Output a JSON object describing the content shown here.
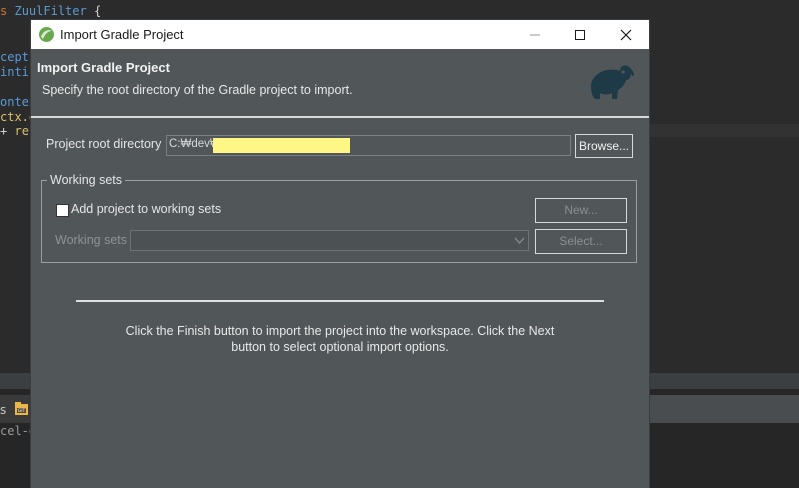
{
  "dialog": {
    "title": "Import Gradle Project",
    "header_title": "Import Gradle Project",
    "header_description": "Specify the root directory of the Gradle project to import.",
    "project_root_label": "Project root directory",
    "project_root_value": "C:₩dev₩",
    "browse_label": "Browse...",
    "working_sets_group_label": "Working sets",
    "add_to_working_sets_label": "Add project to working sets",
    "add_to_working_sets_checked": false,
    "new_label": "New...",
    "working_sets_label": "Working sets",
    "working_sets_value": "",
    "select_label": "Select...",
    "info_text": "Click the Finish button to import the project into the workspace. Click the Next button to select optional import options."
  },
  "background_editor": {
    "code_line_1_kw": "s",
    "code_line_1_type": "ZuulFilter",
    "code_line_1_rest": "{",
    "code_line_2": "cepti",
    "code_line_3": "intin",
    "code_line_4": "ontex",
    "code_line_5": "ctx.g",
    "code_line_6_kw": "+",
    "code_line_6_rest": "rec",
    "bottom_tab_fragment": "s",
    "console_fragment": "cel-do"
  },
  "colors": {
    "dialog_bg": "#515658",
    "editor_bg": "#2b2b2b",
    "redaction": "#fff785",
    "gradle_logo": "#1e3a46"
  },
  "icons": {
    "title": "eclipse-app-icon",
    "logo": "gradle-elephant-icon",
    "minimize": "minimize-icon",
    "maximize": "maximize-icon",
    "close": "close-icon",
    "combo": "chevron-down-icon"
  }
}
